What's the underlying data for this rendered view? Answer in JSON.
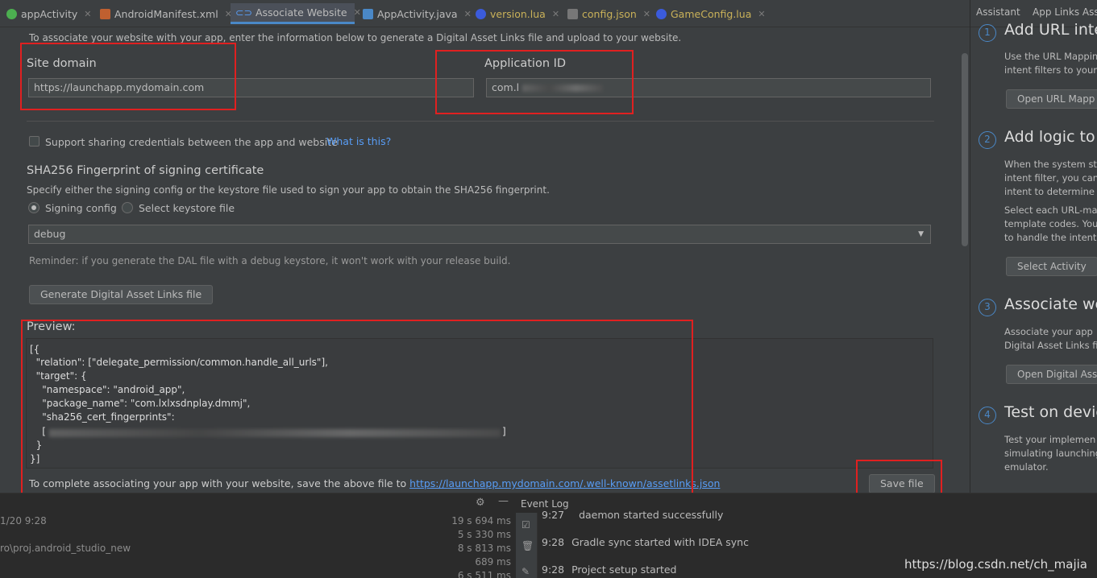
{
  "tabs": [
    {
      "label": "appActivity",
      "icon": "android-class-icon",
      "color": "#4caf50"
    },
    {
      "label": "AndroidManifest.xml",
      "icon": "manifest-icon",
      "color": "#c06030"
    },
    {
      "label": "Associate Website",
      "icon": "link-icon",
      "color": "#589df6",
      "active": true
    },
    {
      "label": "AppActivity.java",
      "icon": "java-file-icon",
      "color": "#4a88c7"
    },
    {
      "label": "version.lua",
      "icon": "lua-file-icon",
      "color": "#3b5bdb"
    },
    {
      "label": "config.json",
      "icon": "json-file-icon",
      "color": "#888888"
    },
    {
      "label": "GameConfig.lua",
      "icon": "lua-file-icon",
      "color": "#3b5bdb"
    }
  ],
  "form": {
    "intro": "To associate your website with your app, enter the information below to generate a Digital Asset Links file and upload to your website.",
    "site_domain_label": "Site domain",
    "site_domain_value": "https://launchapp.mydomain.com",
    "app_id_label": "Application ID",
    "app_id_value": "com.l",
    "share_credentials_label": "Support sharing credentials between the app and website",
    "what_is_this": "What is this?",
    "sha_title": "SHA256 Fingerprint of signing certificate",
    "sha_desc": "Specify either the signing config or the keystore file used to sign your app to obtain the SHA256 fingerprint.",
    "radio_signing": "Signing config",
    "radio_keystore": "Select keystore file",
    "signing_select": "debug",
    "reminder": "Reminder: if you generate the DAL file with a debug keystore, it won't work with your release build.",
    "generate_button": "Generate Digital Asset Links file",
    "preview_label": "Preview:",
    "code": {
      "l1": "[{",
      "l2": "  \"relation\": [\"delegate_permission/common.handle_all_urls\"],",
      "l3": "  \"target\": {",
      "l4": "    \"namespace\": \"android_app\",",
      "l5": "    \"package_name\": \"com.lxlxsdnplay.dmmj\",",
      "l6": "    \"sha256_cert_fingerprints\":",
      "l7": "    [",
      "l7_end": "]",
      "l8": "  }",
      "l9": "}]"
    },
    "complete_text": "To complete associating your app with your website, save the above file to",
    "complete_link": "https://launchapp.mydomain.com/.well-known/assetlinks.json",
    "save_button": "Save file"
  },
  "assistant": {
    "tabs": [
      "Assistant",
      "App Links Ass"
    ],
    "steps": [
      {
        "num": "1",
        "title": "Add URL inten",
        "text": [
          "Use the URL Mappin",
          "intent filters to your"
        ],
        "button": "Open URL Mapp"
      },
      {
        "num": "2",
        "title": "Add logic to h",
        "text": [
          "When the system sta",
          "intent filter, you can",
          "intent to determine y",
          "Select each URL-ma",
          "template codes. You",
          "to handle the intent"
        ],
        "button": "Select Activity"
      },
      {
        "num": "3",
        "title": "Associate web",
        "text": [
          "Associate your app",
          "Digital Asset Links fi"
        ],
        "button": "Open Digital Asse"
      },
      {
        "num": "4",
        "title": "Test on device",
        "text": [
          "Test your implemen",
          "simulating launching",
          "emulator."
        ]
      }
    ]
  },
  "bottom": {
    "left_date": "1/20 9:28",
    "left_path": "ro\\proj.android_studio_new",
    "times": [
      "19 s 694 ms",
      "5 s 330 ms",
      "8 s 813 ms",
      "689 ms",
      "6 s 511 ms"
    ],
    "event_log_title": "Event Log",
    "log": [
      {
        "time": "9:27",
        "msg": "daemon started successfully"
      },
      {
        "time": "9:28",
        "msg": "Gradle sync started with IDEA sync"
      },
      {
        "time": "9:28",
        "msg": "Project setup started"
      }
    ],
    "watermark": "https://blog.csdn.net/ch_majia"
  }
}
